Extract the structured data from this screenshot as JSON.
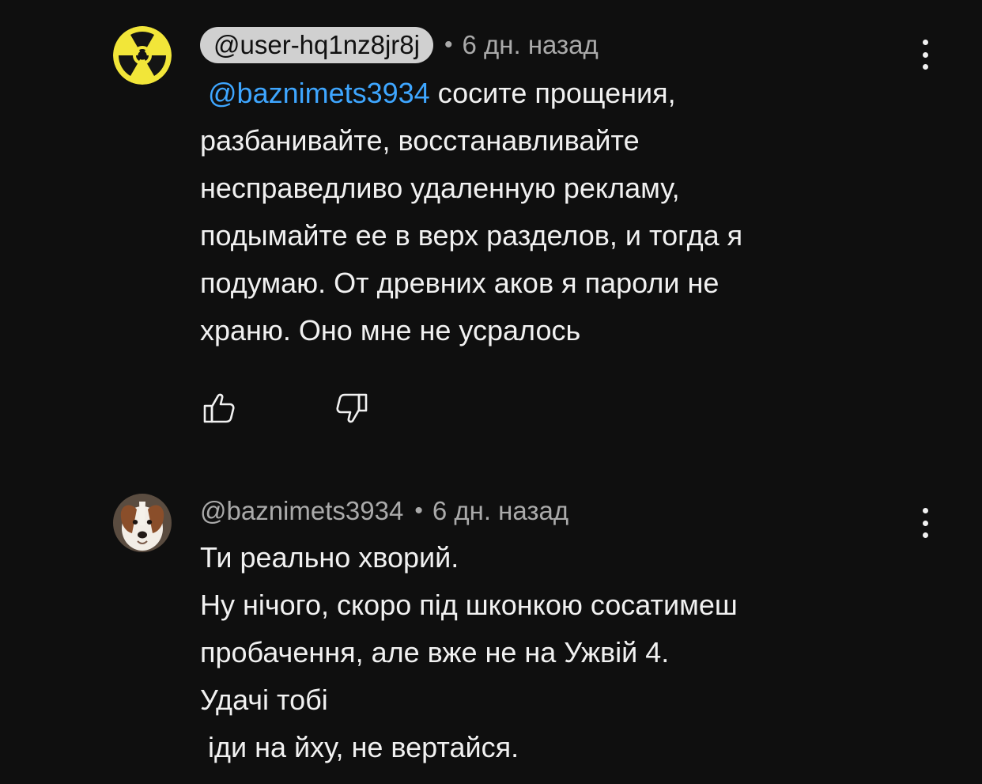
{
  "comments": [
    {
      "author": "@user-hq1nz8jr8j",
      "separator": "•",
      "time": "6 дн. назад",
      "avatar_icon": "radiation-icon",
      "mention": "@baznimets3934",
      "lines": [
        "сосите прощения,",
        "разбанивайте, восстанавливайте",
        "несправедливо удаленную рекламу,",
        "подымайте ее в верх разделов, и тогда я",
        "подумаю. От древних аков я пароли не",
        "храню. Оно мне не усралось"
      ],
      "like_icon": "thumbs-up-icon",
      "dislike_icon": "thumbs-down-icon",
      "menu_icon": "more-vertical-icon"
    },
    {
      "author": "@baznimets3934",
      "separator": "•",
      "time": "6 дн. назад",
      "avatar_icon": "dog-avatar",
      "lines": [
        "Ти реально хворий.",
        "Ну нічого, скоро під шконкою сосатимеш",
        "пробачення, але вже не на Ужвій 4.",
        "Удачі тобі",
        " іди на йху, не вертайся."
      ],
      "menu_icon": "more-vertical-icon"
    }
  ],
  "colors": {
    "background": "#0f0f0f",
    "text": "#f1f1f1",
    "secondary": "#aaaaaa",
    "mention": "#3ea6ff",
    "author_pill": "#d0d0d0",
    "radiation_yellow": "#f2e639"
  }
}
